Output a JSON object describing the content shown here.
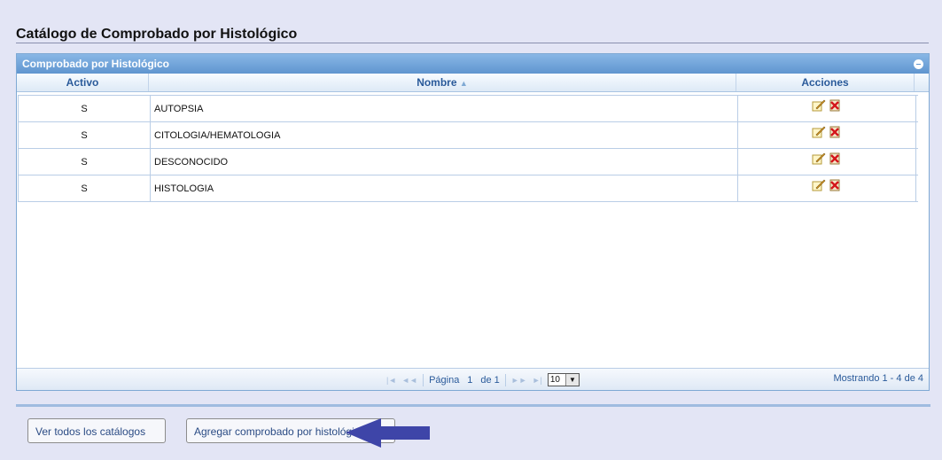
{
  "page": {
    "title": "Catálogo de Comprobado por Histológico"
  },
  "grid": {
    "caption": "Comprobado por Histológico",
    "columns": {
      "activo": "Activo",
      "nombre": "Nombre",
      "acciones": "Acciones"
    },
    "sort_indicator": "▲",
    "rows": [
      {
        "activo": "S",
        "nombre": "AUTOPSIA"
      },
      {
        "activo": "S",
        "nombre": "CITOLOGIA/HEMATOLOGIA"
      },
      {
        "activo": "S",
        "nombre": "DESCONOCIDO"
      },
      {
        "activo": "S",
        "nombre": "HISTOLOGIA"
      }
    ],
    "row_actions": [
      "edit-icon",
      "delete-icon"
    ],
    "pager": {
      "page_label": "Página",
      "page_value": "1",
      "of_label": "de 1",
      "rows_per_page": "10",
      "info": "Mostrando 1 - 4 de 4"
    }
  },
  "buttons": {
    "ver_todos": "Ver todos los catálogos",
    "agregar": "Agregar comprobado por histológico"
  },
  "colors": {
    "caption_bg": "#6fa2d8",
    "header_text": "#2a5a9a",
    "arrow": "#3e45a8",
    "background": "#e3e5f5"
  }
}
